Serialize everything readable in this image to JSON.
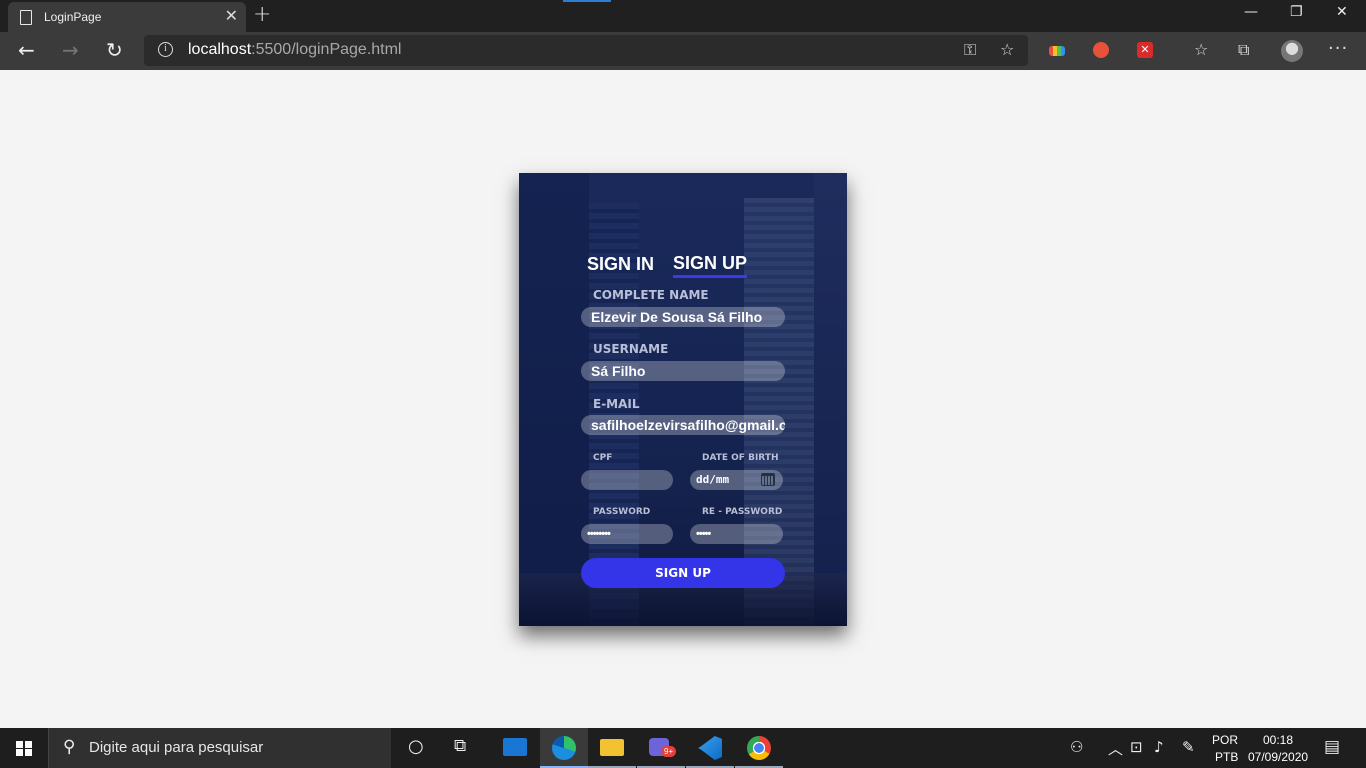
{
  "browser": {
    "tab_title": "LoginPage",
    "tab_close": "✕",
    "new_tab": "+",
    "url_host": "localhost",
    "url_rest": ":5500/loginPage.html",
    "window_minimize": "—",
    "window_restore": "❐",
    "window_close": "✕"
  },
  "form": {
    "tab_signin": "SIGN IN",
    "tab_signup": "SIGN UP",
    "active_tab": "signup",
    "complete_name_label": "COMPLETE NAME",
    "complete_name_value": "Elzevir De Sousa Sá Filho",
    "username_label": "USERNAME",
    "username_value": "Sá Filho",
    "email_label": "E-MAIL",
    "email_value": "safilhoelzevirsafilho@gmail.c",
    "cpf_label": "CPF",
    "cpf_value": "",
    "dob_label": "DATE OF BIRTH",
    "dob_value": "dd/mm",
    "password_label": "PASSWORD",
    "password_value": "••••••••",
    "repassword_label": "RE - PASSWORD",
    "repassword_value": "•••••",
    "submit_label": "SIGN UP",
    "accent_color": "#3434e8"
  },
  "taskbar": {
    "search_placeholder": "Digite aqui para pesquisar",
    "language_top": "POR",
    "language_bottom": "PTB",
    "time": "00:18",
    "date": "07/09/2020",
    "chat_badge": "9+"
  }
}
